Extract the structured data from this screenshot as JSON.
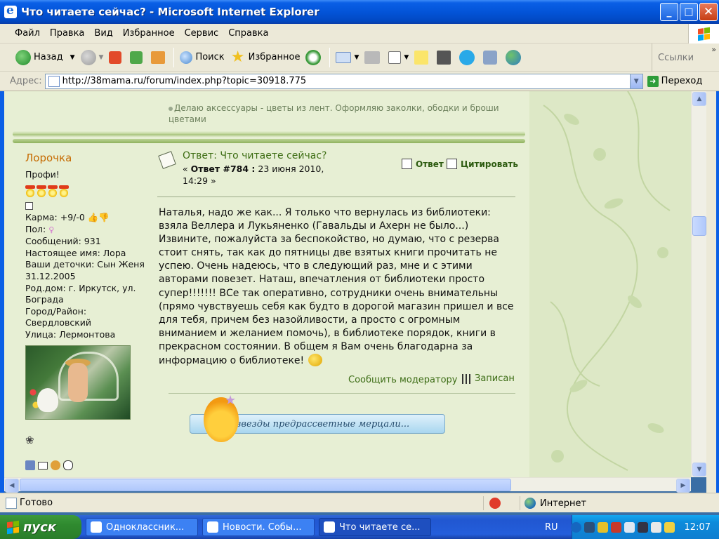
{
  "window": {
    "title": "Что читаете сейчас? - Microsoft Internet Explorer",
    "minimize": "_",
    "maximize": "□",
    "close": "✕"
  },
  "menu": [
    "Файл",
    "Правка",
    "Вид",
    "Избранное",
    "Сервис",
    "Справка"
  ],
  "toolbar": {
    "back": "Назад",
    "search": "Поиск",
    "favorites": "Избранное",
    "links": "Ссылки"
  },
  "address": {
    "label": "Адрес:",
    "url": "http://38mama.ru/forum/index.php?topic=30918.775",
    "go": "Переход"
  },
  "page": {
    "prev_signature": "Делаю аксессуары - цветы из лент. Оформляю заколки, ободки и броши цветами",
    "user": {
      "name": "Лорочка",
      "rank": "Профи!",
      "info": [
        "Карма: +9/-0",
        "Пол:",
        "Сообщений: 931",
        "Настоящее имя: Лора",
        "Ваши деточки: Сын Женя 31.12.2005",
        "Род.дом: г. Иркутск, ул. Боградa",
        "Город/Район: Свердловский",
        "Улица: Лермонтова"
      ]
    },
    "post": {
      "title": "Ответ: Что читаете сейчас?",
      "meta_prefix": "« ",
      "meta_bold": "Ответ #784 :",
      "meta_date": " 23 июня 2010, 14:29 »",
      "reply": "Ответ",
      "quote": "Цитировать",
      "body": "Наталья, надо же как... Я только что вернулась из библиотеки: взяла Веллера и Лукьяненко (Гавальды и Ахерн не было...) Извините, пожалуйста за беспокойство, но думаю, что с резерва стоит снять, так как до пятницы две взятых книги прочитать не успею. Очень надеюсь, что в следующий раз, мне и с этими авторами повезет. Наташ, впечатления от библиотеки просто супер!!!!!!! ВСе так оперативно, сотрудники очень внимательны (прямо чувствуешь себя как будто в дорогой магазин пришел и все для тебя, причем без назойливости, а просто с огромным вниманием и желанием помочь), в библиотеке порядок, книги в прекрасном состоянии. В общем я Вам очень благодарна за информацию о библиотеке!",
      "report": "Сообщить модератору",
      "saved": "Записан",
      "banner": "И звезды предрассветные мерцали..."
    }
  },
  "status": {
    "text": "Готово",
    "zone": "Интернет"
  },
  "taskbar": {
    "start": "пуск",
    "tasks": [
      "Одноклассник...",
      "Новости. Собы...",
      "Что читаете се..."
    ],
    "lang": "RU",
    "clock": "12:07"
  },
  "colors": {
    "xp_blue": "#0a5fe6",
    "page_bg": "#e7efd4",
    "link_green": "#3e6e14",
    "username": "#c66a00"
  }
}
